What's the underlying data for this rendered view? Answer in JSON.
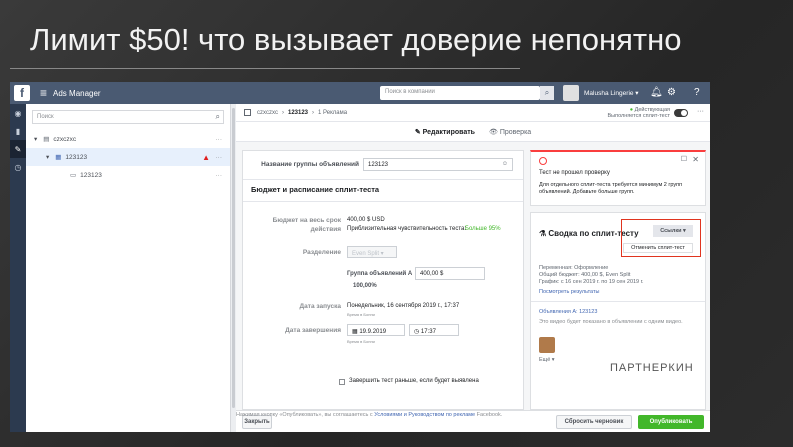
{
  "slide": {
    "title": "Лимит $50! что вызывает доверие непонятно"
  },
  "topbar": {
    "app_title": "Ads Manager",
    "search_placeholder": "Поиск в компании",
    "account_name": "Malusha Lingerie ▾"
  },
  "tree": {
    "search_placeholder": "Поиск",
    "items": [
      {
        "label": "czxczxc"
      },
      {
        "label": "123123"
      },
      {
        "label": "123123"
      }
    ]
  },
  "breadcrumb": {
    "campaign": "czxczxc",
    "adset": "123123",
    "ads": "1 Реклама"
  },
  "status": {
    "line1": "Действующая",
    "line2": "Выполняется сплит-тест"
  },
  "tabs": {
    "edit": "Редактировать",
    "review": "Проверка"
  },
  "form": {
    "adset_name_label": "Название группы объявлений",
    "adset_name_value": "123123",
    "section_title": "Бюджет и расписание сплит-теста",
    "budget_label_1": "Бюджет на весь срок",
    "budget_label_2": "действия",
    "budget_value": "400,00 $ USD",
    "sensitivity_text": "Приблизительная чувствительность теста:",
    "sensitivity_value": "Больше 95%",
    "split_label": "Разделение",
    "split_value": "Even Split ▾",
    "group_a_label": "Группа объявлений А",
    "group_a_value": "400,00 $",
    "group_a_pct": "100,00%",
    "start_label": "Дата запуска",
    "start_value": "Понедельник, 16 сентября 2019 г., 17:37",
    "start_tz": "Время в Бонни",
    "end_label": "Дата завершения",
    "end_date": "19.9.2019",
    "end_time": "17:37",
    "end_tz": "Время в Бонни",
    "early_end": "Завершить тест раньше, если будет выявлена"
  },
  "error": {
    "title": "Тест не прошел проверку",
    "desc": "Для отдельного сплит-теста требуется минимум 2 групп объявлений. Добавьте больше групп."
  },
  "summary": {
    "title": "Сводка по сплит-тесту",
    "links_button": "Ссылки ▾",
    "dropdown_item": "Отменить сплит-тест",
    "var_line1": "Переменная: Оформление",
    "var_line2": "Общий бюджет: 400,00 $, Even Split",
    "var_line3": "График: с 16 сен 2019 г. по 19 сен 2019 г.",
    "results_link": "Посмотреть результаты",
    "ads_a": "Объявления А: 123123",
    "ads_a_desc": "Это видео будет показано в объявлении с одним видео.",
    "more": "Ещё ▾"
  },
  "footer": {
    "close": "Закрыть",
    "draft": "Сбросить черновик",
    "publish": "Опубликовать",
    "legal_pre": "Нажимая кнопку «Опубликовать», вы соглашаетесь с",
    "legal_link": "Условиями и Руководством по рекламе",
    "legal_post": "Facebook."
  },
  "watermark": "ПАРТНЕРКИН"
}
